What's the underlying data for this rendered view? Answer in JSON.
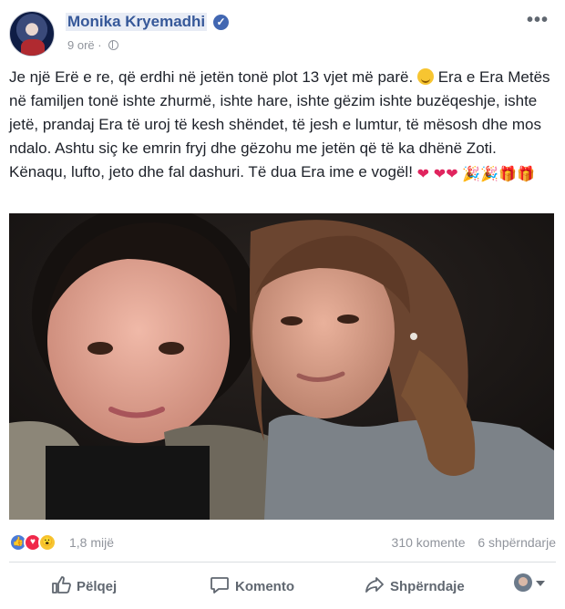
{
  "post": {
    "author": "Monika Kryemadhi",
    "verified_mark": "✓",
    "time": "9 orë",
    "more_label": "•••",
    "body_parts": {
      "p1": "Je një Erë e re, që erdhi në jetën tonë plot 13 vjet më parë.",
      "p2": "Era e Era Metës në familjen tonë ishte zhurmë, ishte hare, ishte gëzim ishte buzëqeshje, ishte jetë, prandaj Era të uroj të kesh shëndet, të jesh e lumtur, të mësosh dhe mos ndalo. Ashtu siç ke emrin fryj dhe gëzohu me jetën që të ka dhënë Zoti. Kënaqu, lufto, jeto dhe fal dashuri. Të dua Era ime e vogël!"
    },
    "emoji": {
      "heart": "❤",
      "party": "🎉",
      "gift": "🎁"
    },
    "reactions": {
      "like_glyph": "👍",
      "love_glyph": "♥",
      "wow_glyph": "😮",
      "count": "1,8 mijë"
    },
    "stats": {
      "comments": "310 komente",
      "shares": "6 shpërndarje"
    },
    "actions": {
      "like": "Pëlqej",
      "comment": "Komento",
      "share": "Shpërndaje"
    },
    "colors": {
      "link": "#365899",
      "meta": "#90949c",
      "like_blue": "#4a7bd8",
      "love_red": "#f0284a",
      "wow_yellow": "#f7c531"
    },
    "icons": [
      "gear-icon",
      "globe-icon",
      "verified-icon",
      "like-icon",
      "comment-icon",
      "share-icon",
      "caret-down-icon"
    ]
  }
}
